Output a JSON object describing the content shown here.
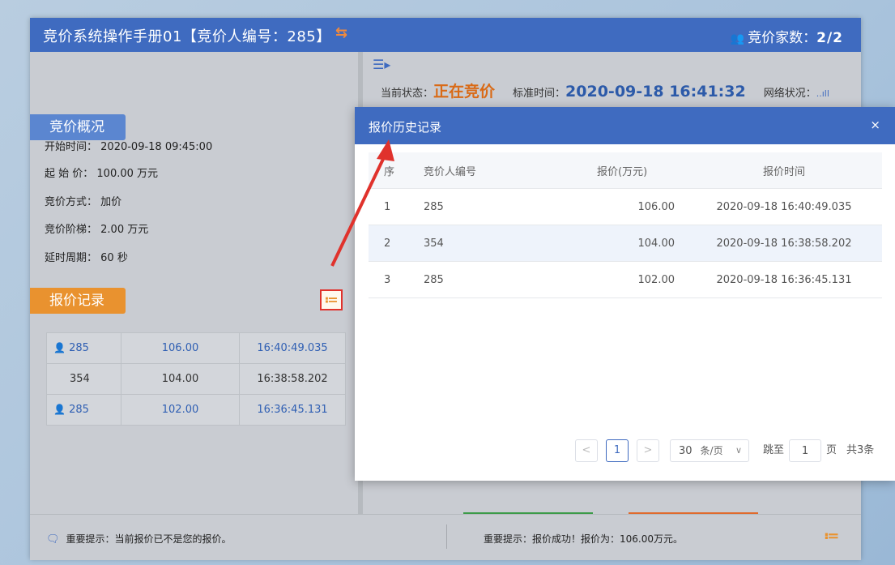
{
  "window": {
    "title": "竞价系统操作手册01【竞价人编号：285】",
    "bidders_label": "竞价家数：",
    "bidders_count": "2/2"
  },
  "overview": {
    "pill": "竞价概况",
    "rows": [
      {
        "label": "开始时间：",
        "value": "2020-09-18 09:45:00"
      },
      {
        "label": "起 始 价：",
        "value": "100.00 万元"
      },
      {
        "label": "竞价方式：",
        "value": "加价"
      },
      {
        "label": "竞价阶梯：",
        "value": "2.00 万元"
      },
      {
        "label": "延时周期：",
        "value": "60 秒"
      }
    ]
  },
  "bid_records": {
    "pill": "报价记录",
    "rows": [
      {
        "bidder": "285",
        "price": "106.00",
        "time": "16:40:49.035",
        "mine": true
      },
      {
        "bidder": "354",
        "price": "104.00",
        "time": "16:38:58.202",
        "mine": false
      },
      {
        "bidder": "285",
        "price": "102.00",
        "time": "16:36:45.131",
        "mine": true
      }
    ]
  },
  "status": {
    "state_label": "当前状态：",
    "state_value": "正在竞价",
    "time_label": "标准时间：",
    "time_value": "2020-09-18 16:41:32",
    "network_label": "网络状况：",
    "network_value": "..ıll"
  },
  "modal": {
    "title": "报价历史记录",
    "close": "×",
    "columns": [
      "序",
      "竞价人编号",
      "报价(万元)",
      "报价时间"
    ],
    "rows": [
      {
        "seq": "1",
        "bidder": "285",
        "price": "106.00",
        "time": "2020-09-18 16:40:49.035"
      },
      {
        "seq": "2",
        "bidder": "354",
        "price": "104.00",
        "time": "2020-09-18 16:38:58.202"
      },
      {
        "seq": "3",
        "bidder": "285",
        "price": "102.00",
        "time": "2020-09-18 16:36:45.131"
      }
    ],
    "pager": {
      "prev": "<",
      "page": "1",
      "next": ">",
      "page_size": "30",
      "page_size_unit": "条/页",
      "jump_label": "跳至",
      "jump_value": "1",
      "page_unit": "页",
      "total": "共3条"
    }
  },
  "footer": {
    "left_notice": "重要提示：当前报价已不是您的报价。",
    "right_notice": "重要提示：报价成功！报价为：106.00万元。"
  },
  "colors": {
    "titlebar": "#3f6bc0",
    "accent_orange": "#e9922f",
    "highlight_red": "#e0322c"
  }
}
